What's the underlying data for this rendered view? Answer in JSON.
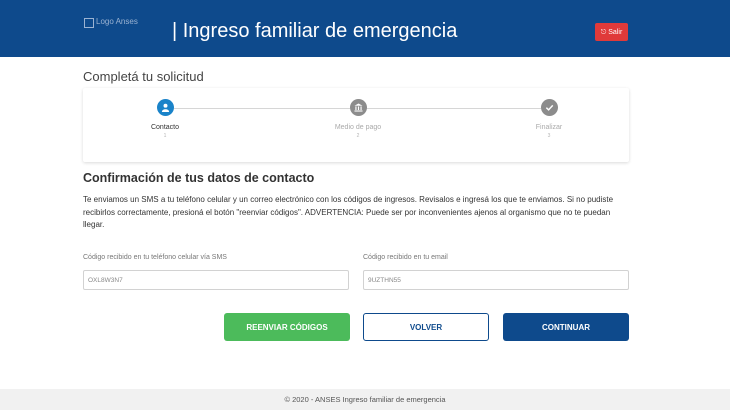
{
  "header": {
    "logo_alt": "Logo Anses",
    "title": "| Ingreso familiar de emergencia",
    "logout_label": "Salir",
    "logout_icon": "sign-out-icon"
  },
  "request": {
    "title": "Completá tu solicitud"
  },
  "stepper": {
    "steps": [
      {
        "label": "Contacto",
        "number": "1",
        "state": "active",
        "icon": "user-icon"
      },
      {
        "label": "Medio de pago",
        "number": "2",
        "state": "pending",
        "icon": "bank-icon"
      },
      {
        "label": "Finalizar",
        "number": "3",
        "state": "pending",
        "icon": "check-icon"
      }
    ]
  },
  "form": {
    "title": "Confirmación de tus datos de contacto",
    "description": "Te enviamos un SMS a tu teléfono celular y un correo electrónico con los códigos de ingresos. Revisalos e ingresá los que te enviamos. Si no pudiste recibirlos correctamente, presioná el botón \"reenviar códigos\". ADVERTENCIA: Puede ser por inconvenientes ajenos al organismo que no te puedan llegar.",
    "sms_label": "Código recibido en tu teléfono celular vía SMS",
    "sms_value": "OXL8W3N7",
    "email_label": "Código recibido en tu email",
    "email_value": "9UZTHN55"
  },
  "actions": {
    "resend": "REENVIAR CÓDIGOS",
    "back": "VOLVER",
    "continue": "CONTINUAR"
  },
  "footer": {
    "text": "© 2020 - ANSES Ingreso familiar de emergencia"
  },
  "colors": {
    "header_bg": "#0e4a8c",
    "active_step": "#1a83c9",
    "resend_button": "#4cbb5b",
    "logout_button": "#e03a3a"
  }
}
